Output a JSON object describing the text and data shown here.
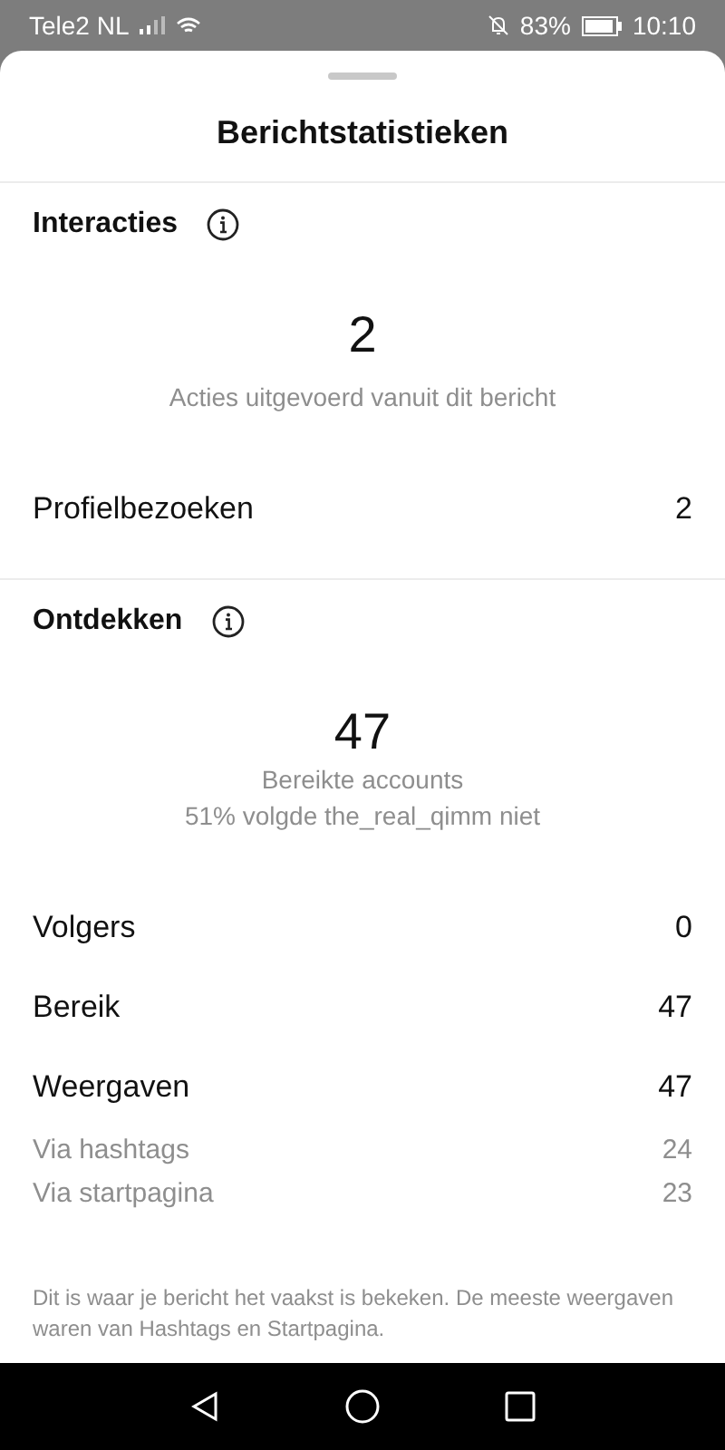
{
  "status_bar": {
    "carrier": "Tele2 NL",
    "battery": "83%",
    "time": "10:10"
  },
  "title": "Berichtstatistieken",
  "sections": [
    {
      "heading": "Interacties",
      "big_number": "2",
      "captions": [
        "Acties uitgevoerd vanuit dit bericht"
      ],
      "rows": [
        {
          "kind": "main",
          "label": "Profielbezoeken",
          "value": "2"
        }
      ]
    },
    {
      "heading": "Ontdekken",
      "big_number": "47",
      "captions": [
        "Bereikte accounts",
        "51% volgde the_real_qimm niet"
      ],
      "rows": [
        {
          "kind": "main",
          "label": "Volgers",
          "value": "0"
        },
        {
          "kind": "main",
          "label": "Bereik",
          "value": "47"
        },
        {
          "kind": "main",
          "label": "Weergaven",
          "value": "47"
        },
        {
          "kind": "sub",
          "label": "Via hashtags",
          "value": "24"
        },
        {
          "kind": "sub",
          "label": "Via startpagina",
          "value": "23"
        }
      ],
      "note": "Dit is waar je bericht het vaakst is bekeken. De meeste weergaven waren van Hashtags en Startpagina."
    }
  ]
}
